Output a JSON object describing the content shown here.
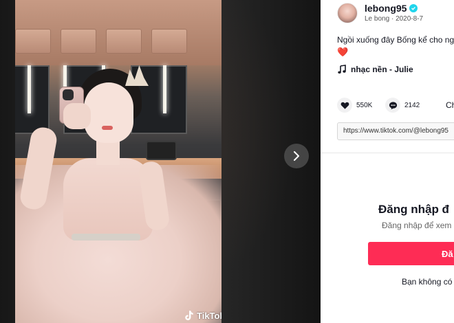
{
  "video": {
    "watermark": "TikTok",
    "next_icon": "chevron-right-icon"
  },
  "author": {
    "username": "lebong95",
    "display_name": "Le bong",
    "separator": "·",
    "date": "2020-8-7",
    "verified": true
  },
  "post": {
    "caption": "Ngồi xuống đây Bống kể cho ng",
    "caption_emoji": "❤️",
    "music_label": "nhạc nền - Julie"
  },
  "stats": {
    "likes": "550K",
    "comments": "2142",
    "share_partial": "Ch"
  },
  "link": {
    "url": "https://www.tiktok.com/@lebong95"
  },
  "login": {
    "title": "Đăng nhập đ",
    "subtitle": "Đăng nhập để xem",
    "button_label": "Đă",
    "signup_prompt": "Bạn không có"
  },
  "colors": {
    "accent": "#fe2c55",
    "verified": "#20d5ec",
    "heart": "#e8112d"
  }
}
